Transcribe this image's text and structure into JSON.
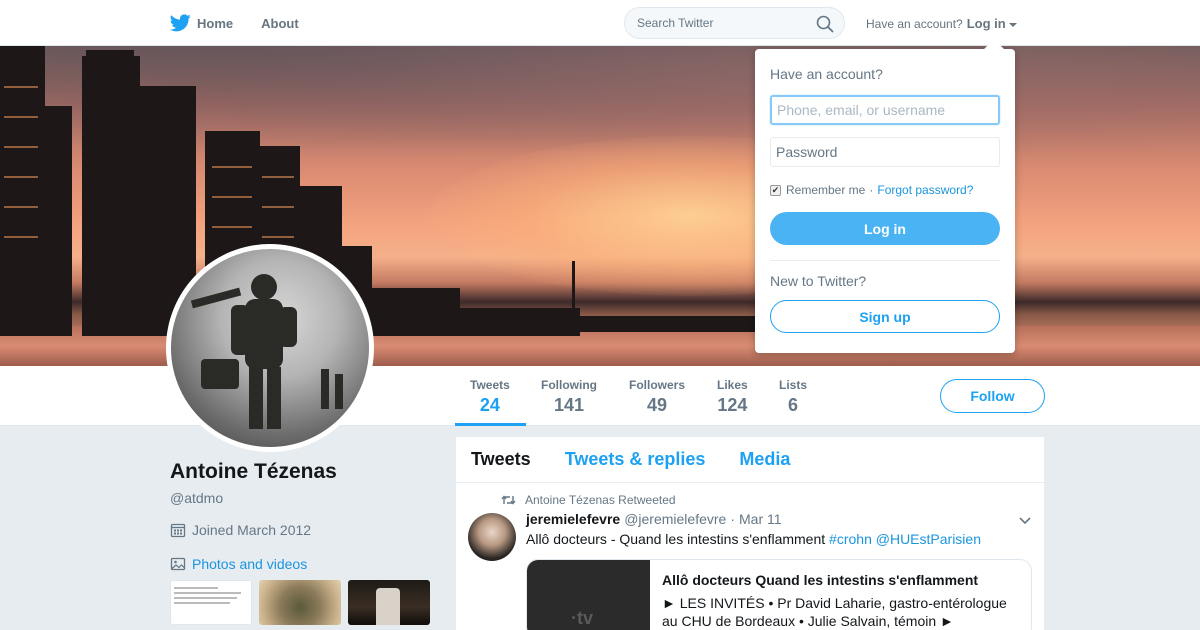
{
  "nav": {
    "home_label": "Home",
    "about_label": "About"
  },
  "search": {
    "placeholder": "Search Twitter"
  },
  "account": {
    "prompt": "Have an account?",
    "login_label": "Log in"
  },
  "profile": {
    "name": "Antoine Tézenas",
    "handle": "@atdmo",
    "joined": "Joined March 2012",
    "photos_label": "Photos and videos"
  },
  "stats": [
    {
      "label": "Tweets",
      "value": "24"
    },
    {
      "label": "Following",
      "value": "141"
    },
    {
      "label": "Followers",
      "value": "49"
    },
    {
      "label": "Likes",
      "value": "124"
    },
    {
      "label": "Lists",
      "value": "6"
    }
  ],
  "follow_label": "Follow",
  "timeline": {
    "tabs": [
      "Tweets",
      "Tweets & replies",
      "Media"
    ],
    "tweet": {
      "retweeted_by": "Antoine Tézenas Retweeted",
      "fullname": "jeremielefevre",
      "screen_name": "@jeremielefevre",
      "separator": "·",
      "date": "Mar 11",
      "text": "Allô docteurs - Quand les intestins s'enflamment",
      "hashtag": "#crohn",
      "mention": "@HUEstParisien",
      "card": {
        "image_label": "·tv",
        "title": "Allô docteurs Quand les intestins s'enflamment",
        "description": "► LES INVITÉS   • Pr David Laharie, gastro-entérologue au CHU de Bordeaux • Julie Salvain, témoin     ►"
      }
    }
  },
  "login_dropdown": {
    "title": "Have an account?",
    "username_placeholder": "Phone, email, or username",
    "password_placeholder": "Password",
    "remember_label": "Remember me",
    "separator": "·",
    "forgot_label": "Forgot password?",
    "login_button": "Log in",
    "new_prompt": "New to Twitter?",
    "signup_button": "Sign up"
  },
  "colors": {
    "accent": "#1da1f2",
    "login_button": "#4ab3f4",
    "background": "#e6ecf0"
  }
}
